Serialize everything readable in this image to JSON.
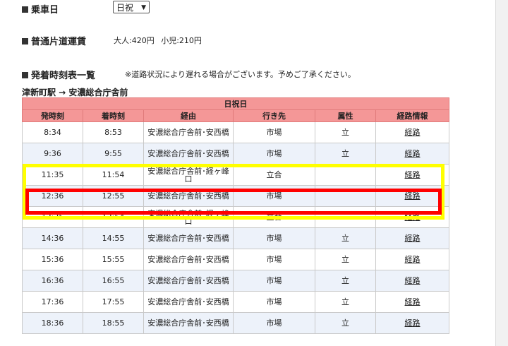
{
  "ride_date": {
    "label": "乗車日",
    "select_value": "日祝"
  },
  "fare": {
    "label": "普通片道運賃",
    "adult": "大人:420円",
    "child": "小児:210円"
  },
  "timetable": {
    "label": "発着時刻表一覧",
    "note": "※道路状況により遅れる場合がございます。予めご了承ください。",
    "route": "津新町駅 → 安濃総合庁舎前",
    "day_type": "日祝日",
    "headers": [
      "発時刻",
      "着時刻",
      "経由",
      "行き先",
      "属性",
      "経路情報"
    ],
    "rows": [
      {
        "dep": "8:34",
        "arr": "8:53",
        "via": "安濃総合庁舎前･安西橋",
        "dest": "市場",
        "attr": "立",
        "link": "経路"
      },
      {
        "dep": "9:36",
        "arr": "9:55",
        "via": "安濃総合庁舎前･安西橋",
        "dest": "市場",
        "attr": "立",
        "link": "経路"
      },
      {
        "dep": "11:35",
        "arr": "11:54",
        "via": "安濃総合庁舎前･経ヶ峰口",
        "dest": "立合",
        "attr": "",
        "link": "経路"
      },
      {
        "dep": "12:36",
        "arr": "12:55",
        "via": "安濃総合庁舎前･安西橋",
        "dest": "市場",
        "attr": "",
        "link": "経路"
      },
      {
        "dep": "13:35",
        "arr": "13:54",
        "via": "安濃総合庁舎前･経ヶ峰口",
        "dest": "立合",
        "attr": "",
        "link": "経路"
      },
      {
        "dep": "14:36",
        "arr": "14:55",
        "via": "安濃総合庁舎前･安西橋",
        "dest": "市場",
        "attr": "立",
        "link": "経路"
      },
      {
        "dep": "15:36",
        "arr": "15:55",
        "via": "安濃総合庁舎前･安西橋",
        "dest": "市場",
        "attr": "立",
        "link": "経路"
      },
      {
        "dep": "16:36",
        "arr": "16:55",
        "via": "安濃総合庁舎前･安西橋",
        "dest": "市場",
        "attr": "立",
        "link": "経路"
      },
      {
        "dep": "17:36",
        "arr": "17:55",
        "via": "安濃総合庁舎前･安西橋",
        "dest": "市場",
        "attr": "立",
        "link": "経路"
      },
      {
        "dep": "18:36",
        "arr": "18:55",
        "via": "安濃総合庁舎前･安西橋",
        "dest": "市場",
        "attr": "立",
        "link": "経路"
      }
    ]
  },
  "colors": {
    "header_bg": "#f49797",
    "row_alt_bg": "#edf2fa",
    "highlight_yellow": "#ffff00",
    "highlight_red": "#ff0000"
  }
}
